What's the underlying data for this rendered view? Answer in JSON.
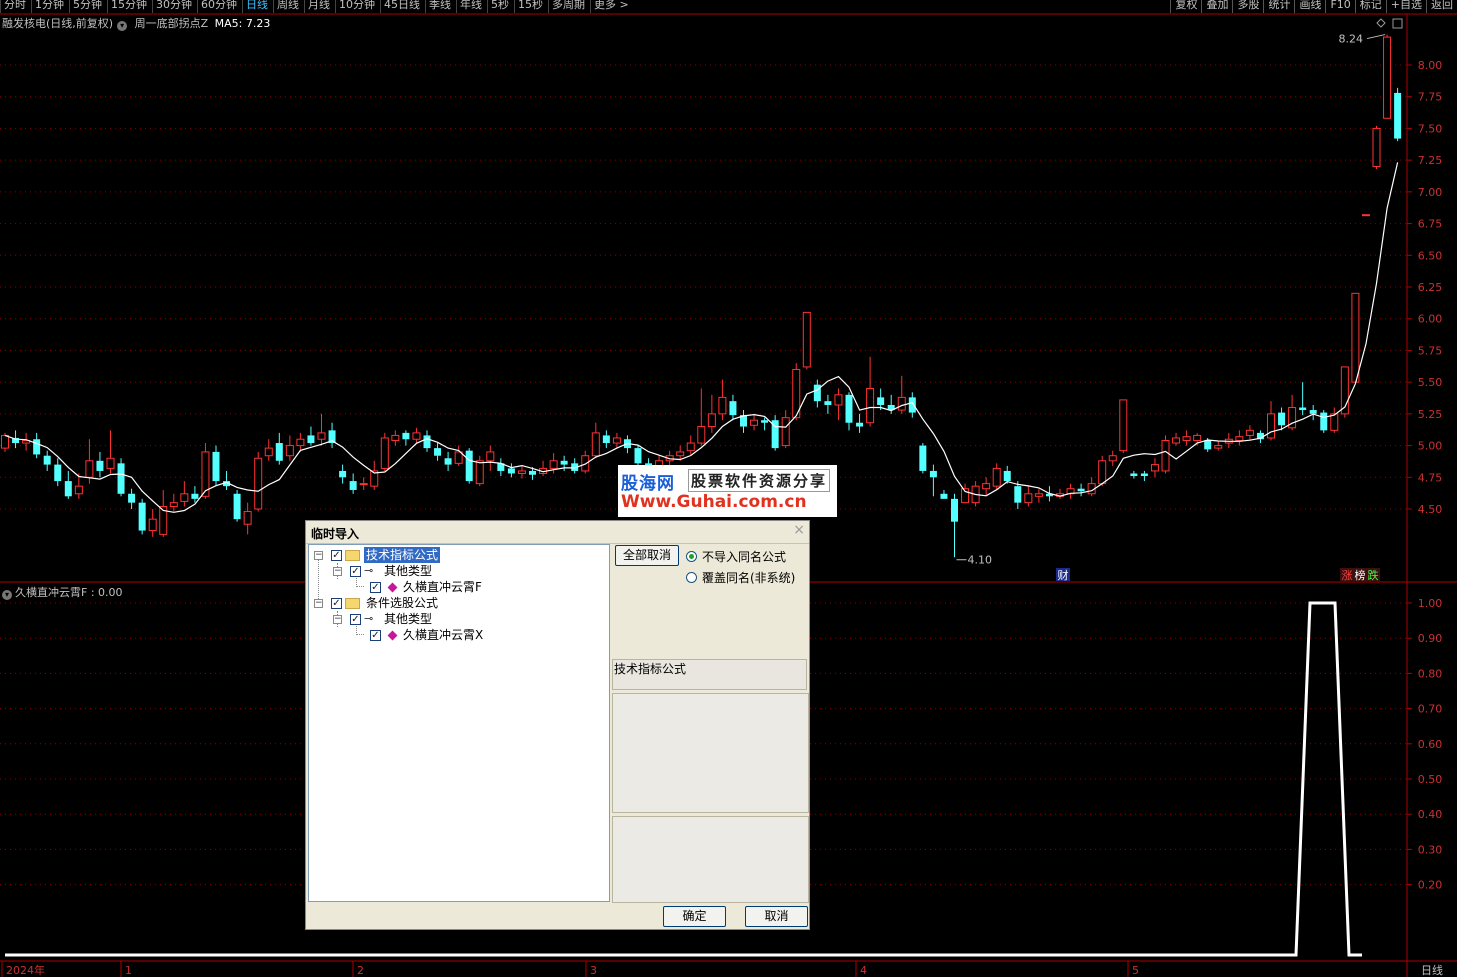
{
  "toolbar": {
    "tabs": [
      "分时",
      "1分钟",
      "5分钟",
      "15分钟",
      "30分钟",
      "60分钟",
      "日线",
      "周线",
      "月线",
      "10分钟",
      "45日线",
      "季线",
      "年线",
      "5秒",
      "15秒",
      "多周期",
      "更多 >"
    ],
    "active_tab": "日线",
    "tools": [
      "复权",
      "叠加",
      "多股",
      "统计",
      "画线",
      "F10",
      "标记",
      "+自选",
      "返回"
    ]
  },
  "main_chart": {
    "stock_label": "融发核电(日线,前复权)",
    "indicator_name": "周一底部拐点Z",
    "ma_label": "MA5: 7.23",
    "y_ticks": [
      "8.00",
      "7.75",
      "7.50",
      "7.25",
      "7.00",
      "6.75",
      "6.50",
      "6.25",
      "6.00",
      "5.75",
      "5.50",
      "5.25",
      "5.00",
      "4.75",
      "4.50"
    ],
    "y_tick_values": [
      8.0,
      7.75,
      7.5,
      7.25,
      7.0,
      6.75,
      6.5,
      6.25,
      6.0,
      5.75,
      5.5,
      5.25,
      5.0,
      4.75,
      4.5
    ],
    "high_marker": "8.24",
    "low_marker": "4.10",
    "badge_cai": "财",
    "badge_zhang": "涨",
    "badge_bang": "榜",
    "badge_die": "跌"
  },
  "sub_chart": {
    "header": "久横直冲云霄F : 0.00",
    "y_ticks": [
      "1.00",
      "0.90",
      "0.80",
      "0.70",
      "0.60",
      "0.50",
      "0.40",
      "0.30",
      "0.20"
    ],
    "y_tick_values": [
      1.0,
      0.9,
      0.8,
      0.7,
      0.6,
      0.5,
      0.4,
      0.3,
      0.2
    ]
  },
  "x_axis": {
    "labels": [
      {
        "text": "2024年",
        "month": 0
      },
      {
        "text": "1",
        "month": 1
      },
      {
        "text": "2",
        "month": 2
      },
      {
        "text": "3",
        "month": 3
      },
      {
        "text": "4",
        "month": 4
      },
      {
        "text": "5",
        "month": 5
      }
    ],
    "period_label": "日线"
  },
  "watermark": {
    "brand": "股海网",
    "tagline": "股票软件资源分享",
    "url": "Www.Guhai.com.cn"
  },
  "dialog": {
    "title": "临时导入",
    "close": "×",
    "tree": {
      "group1": "技术指标公式",
      "group1_child": "其他类型",
      "group1_item": "久横直冲云霄F",
      "group2": "条件选股公式",
      "group2_child": "其他类型",
      "group2_item": "久横直冲云霄X"
    },
    "deselect_all": "全部取消",
    "radio_no_import": "不导入同名公式",
    "radio_overwrite": "覆盖同名(非系统)",
    "selected_radio": "不导入同名公式",
    "info_text": "技术指标公式",
    "ok": "确定",
    "cancel": "取消"
  },
  "colors": {
    "up": "#ff3232",
    "down": "#54ffff",
    "ma": "#ffffff",
    "grid": "#8b0000",
    "axis": "#b00000",
    "tick_text": "#c83232"
  }
}
